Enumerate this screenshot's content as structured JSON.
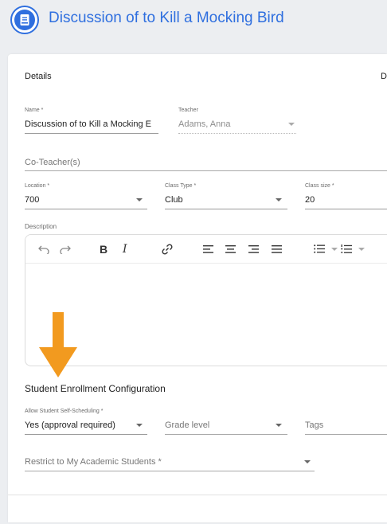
{
  "header": {
    "title": "Discussion of to Kill a Mocking Bird",
    "icon": "book-icon"
  },
  "details": {
    "heading": "Details",
    "right_edge_text": "D",
    "name_label": "Name *",
    "name_value": "Discussion of to Kill a Mocking E",
    "teacher_label": "Teacher",
    "teacher_value": "Adams, Anna",
    "coteacher_placeholder": "Co-Teacher(s)",
    "location_label": "Location *",
    "location_value": "700",
    "class_type_label": "Class Type *",
    "class_type_value": "Club",
    "class_size_label": "Class size *",
    "class_size_value": "20",
    "description_label": "Description"
  },
  "toolbar": {
    "undo": "undo-icon",
    "redo": "redo-icon",
    "bold_label": "B",
    "italic_label": "I",
    "link": "link-icon",
    "align_left": "align-left-icon",
    "align_center": "align-center-icon",
    "align_right": "align-right-icon",
    "align_justify": "align-justify-icon",
    "bullet_list": "bullet-list-icon",
    "numbered_list": "numbered-list-icon"
  },
  "annotation": {
    "arrow": "arrow-down-icon",
    "color": "#f29a1f"
  },
  "enrollment": {
    "heading": "Student Enrollment Configuration",
    "self_sched_label": "Allow Student Self-Scheduling *",
    "self_sched_value": "Yes (approval required)",
    "grade_placeholder": "Grade level",
    "tags_placeholder": "Tags",
    "restrict_placeholder": "Restrict to My Academic Students *"
  },
  "colors": {
    "accent": "#2f6fdf"
  }
}
